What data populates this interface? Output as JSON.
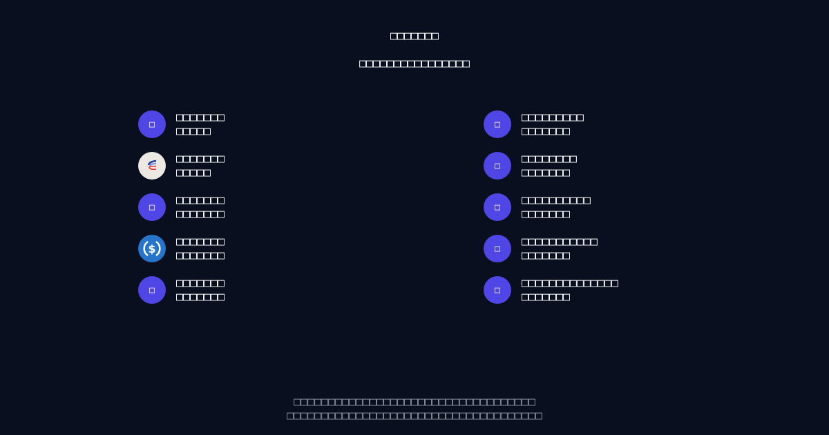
{
  "header": {
    "title": "□□□□□□□",
    "subtitle": "□□□□□□□□□□□□□□□□"
  },
  "left_items": [
    {
      "icon": "placeholder-glyph-icon",
      "glyph": "□",
      "name": "□□□□□□□",
      "detail": "□□□□□"
    },
    {
      "icon": "stripes-logo-icon",
      "glyph": "",
      "name": "□□□□□□□",
      "detail": "□□□□□"
    },
    {
      "icon": "placeholder-glyph-icon",
      "glyph": "□",
      "name": "□□□□□□□",
      "detail": "□□□□□□□"
    },
    {
      "icon": "usdc-dollar-icon",
      "glyph": "",
      "name": "□□□□□□□",
      "detail": "□□□□□□□"
    },
    {
      "icon": "placeholder-glyph-icon",
      "glyph": "□",
      "name": "□□□□□□□",
      "detail": "□□□□□□□"
    }
  ],
  "right_items": [
    {
      "icon": "placeholder-glyph-icon",
      "glyph": "□",
      "name": "□□□□□□□□□",
      "detail": "□□□□□□□"
    },
    {
      "icon": "placeholder-glyph-icon",
      "glyph": "□",
      "name": "□□□□□□□□",
      "detail": "□□□□□□□"
    },
    {
      "icon": "placeholder-glyph-icon",
      "glyph": "□",
      "name": "□□□□□□□□□□",
      "detail": "□□□□□□□"
    },
    {
      "icon": "placeholder-glyph-icon",
      "glyph": "□",
      "name": "□□□□□□□□□□□",
      "detail": "□□□□□□□"
    },
    {
      "icon": "placeholder-glyph-icon",
      "glyph": "□",
      "name": "□□□□□□□□□□□□□□",
      "detail": "□□□□□□□"
    }
  ],
  "footer": {
    "line1": "□□□□□□□□□□□□□□□□□□□□□□□□□□□□□□□□□□□",
    "line2": "□□□□□□□□□□□□□□□□□□□□□□□□□□□□□□□□□□□□□"
  },
  "colors": {
    "background": "#0a0f1f",
    "accent": "#4f46e5",
    "usdc": "#2775ca",
    "muted": "#8a8f9c"
  }
}
